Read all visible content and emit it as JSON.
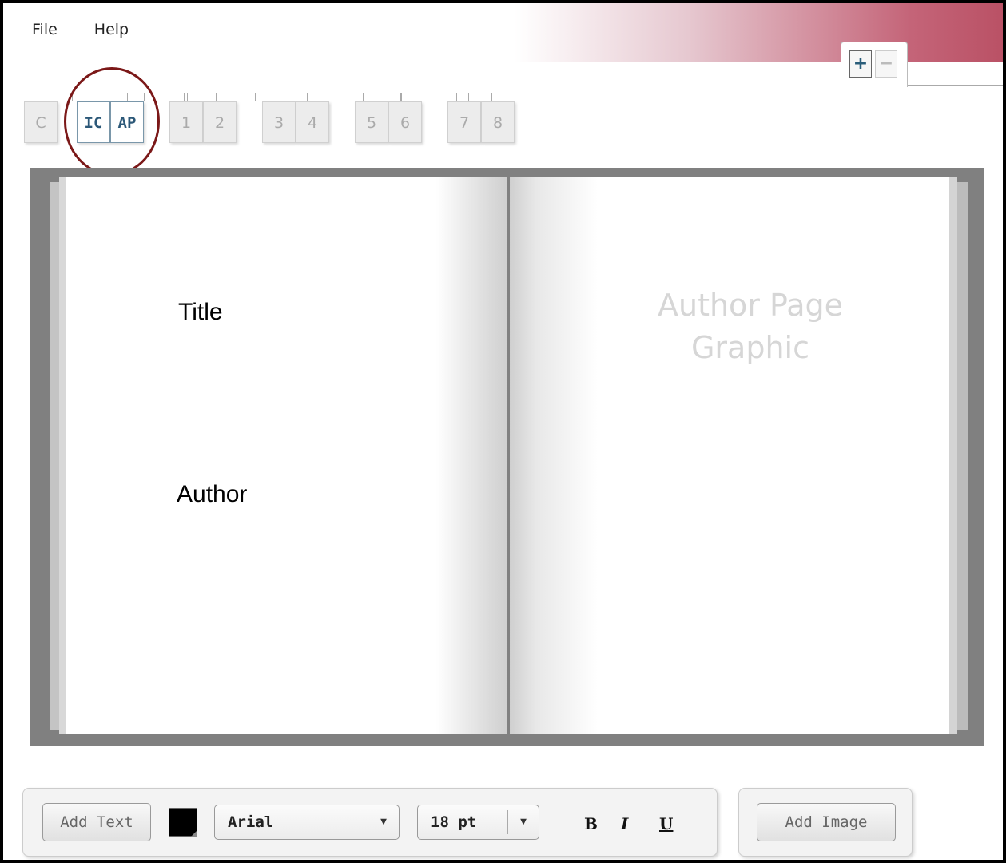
{
  "menu": {
    "file": "File",
    "help": "Help"
  },
  "page_controls": {
    "add_icon": "+",
    "remove_icon": "−"
  },
  "tabs": [
    {
      "label": "C",
      "active": false
    },
    {
      "label": "IC",
      "active": true
    },
    {
      "label": "AP",
      "active": true
    },
    {
      "label": "1",
      "active": false
    },
    {
      "label": "2",
      "active": false
    },
    {
      "label": "3",
      "active": false
    },
    {
      "label": "4",
      "active": false
    },
    {
      "label": "5",
      "active": false
    },
    {
      "label": "6",
      "active": false
    },
    {
      "label": "7",
      "active": false
    },
    {
      "label": "8",
      "active": false
    }
  ],
  "book": {
    "left_title": "Title",
    "left_author": "Author",
    "right_placeholder_line1": "Author Page",
    "right_placeholder_line2": "Graphic"
  },
  "toolbar": {
    "add_text_label": "Add Text",
    "text_color": "#000000",
    "font_value": "Arial",
    "font_size_value": "18 pt",
    "dropdown_arrow": "▼",
    "bold_label": "B",
    "italic_label": "I",
    "underline_label": "U",
    "add_image_label": "Add Image"
  },
  "colors": {
    "active_tab_text": "#2c5878",
    "highlight_circle": "#7b1818",
    "book_background": "#808080"
  }
}
